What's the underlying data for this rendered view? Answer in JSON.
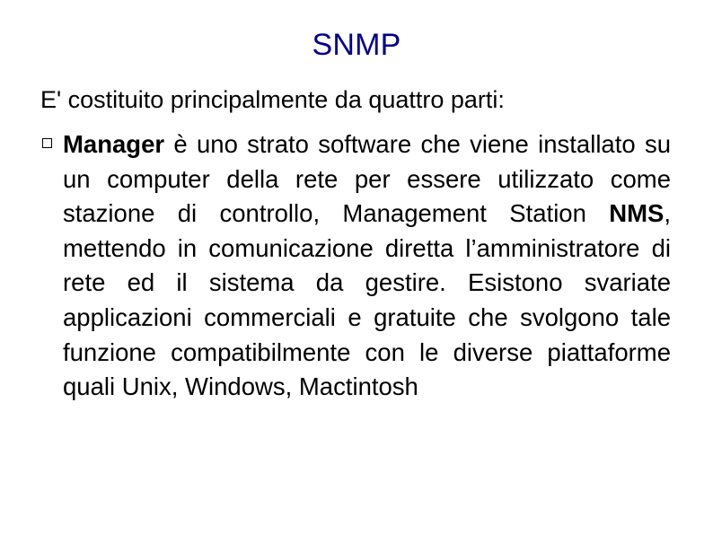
{
  "slide": {
    "title": "SNMP",
    "title_color": "#00008b",
    "intro": "E' costituito principalmente da quattro parti:",
    "bullets": [
      {
        "marker": "hollow-square-bullet",
        "segments": [
          {
            "text": "Manager",
            "bold": true
          },
          {
            "text": " è uno strato software che viene installato su un computer della rete per essere utilizzato come stazione di controllo, Management Station ",
            "bold": false
          },
          {
            "text": "NMS",
            "bold": true
          },
          {
            "text": ", mettendo in comunicazione diretta l’amministratore di rete ed il sistema da gestire. Esistono svariate applicazioni commerciali e gratuite che svolgono tale funzione compatibilmente con le diverse piattaforme quali Unix, Windows, Mactintosh",
            "bold": false
          }
        ],
        "plain_text": "Manager è uno strato software che viene installato su un computer della rete per essere utilizzato come stazione di controllo, Management Station NMS, mettendo in comunicazione diretta l’amministratore di rete ed il sistema da gestire. Esistono svariate applicazioni commerciali e gratuite che svolgono tale funzione compatibilmente con le diverse piattaforme quali Unix, Windows, Mactintosh"
      }
    ]
  }
}
